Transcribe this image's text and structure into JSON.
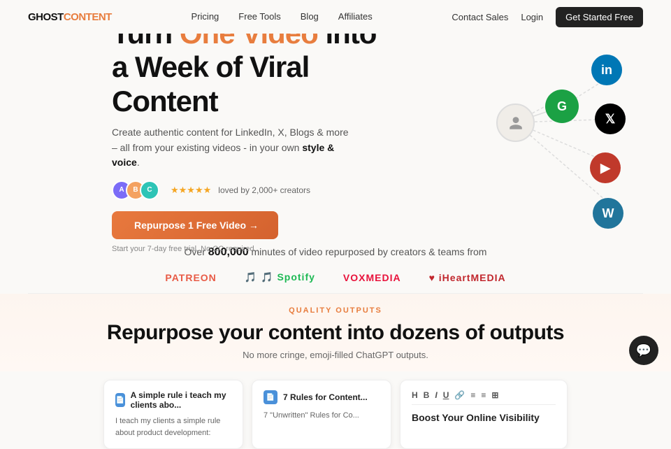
{
  "nav": {
    "logo_ghost": "GHOST",
    "logo_content": "CONTENT",
    "links": [
      {
        "label": "Pricing",
        "href": "#"
      },
      {
        "label": "Free Tools",
        "href": "#"
      },
      {
        "label": "Blog",
        "href": "#"
      },
      {
        "label": "Affiliates",
        "href": "#"
      }
    ],
    "right_links": [
      {
        "label": "Contact Sales"
      },
      {
        "label": "Login"
      },
      {
        "label": "Get Started Free"
      }
    ]
  },
  "hero": {
    "headline_start": "Turn ",
    "headline_orange": "One Video",
    "headline_end": " into a Week of Viral Content",
    "description": "Create authentic content for LinkedIn, X, Blogs & more – all from your existing videos - in your own ",
    "description_bold": "style & voice",
    "description_end": ".",
    "stars": "★★★★★",
    "loved_text": "loved by 2,000+ creators",
    "cta_button": "Repurpose 1 Free Video →",
    "free_trial": "Start your 7-day free trial. No CC required",
    "center_icon": "👤",
    "grammarly_letter": "G"
  },
  "social_icons": [
    {
      "name": "linkedin",
      "symbol": "in",
      "class": "si-linkedin"
    },
    {
      "name": "x-twitter",
      "symbol": "𝕏",
      "class": "si-x"
    },
    {
      "name": "youtube",
      "symbol": "▶",
      "class": "si-youtube"
    },
    {
      "name": "wordpress",
      "symbol": "W",
      "class": "si-wordpress"
    }
  ],
  "stats": {
    "text_before": "Over ",
    "number": "800,000",
    "text_after": " minutes of video repurposed by creators & teams from"
  },
  "brands": [
    {
      "label": "PATREON",
      "class": "patreon"
    },
    {
      "label": "Spotify",
      "class": "spotify"
    },
    {
      "label": "VOXMEDIA",
      "class": "vox"
    },
    {
      "label": "♥ iHeartMEDIA",
      "class": "iheart"
    }
  ],
  "quality_section": {
    "label": "QUALITY OUTPUTS",
    "title": "Repurpose your content into dozens of outputs",
    "subtitle": "No more cringe, emoji-filled ChatGPT outputs."
  },
  "cards": [
    {
      "icon": "📄",
      "title": "A simple rule i teach my clients abo...",
      "body": "I teach my clients a simple rule about product development:"
    },
    {
      "icon": "📄",
      "title": "7 Rules for Content...",
      "body": "7 \"Unwritten\" Rules for Co..."
    }
  ],
  "editor_card": {
    "toolbar_items": [
      "H",
      "B",
      "I",
      "U",
      "🔗",
      "≡",
      "≡",
      "⊞"
    ],
    "title": "Boost Your Online Visibility"
  },
  "chat": {
    "icon": "💬"
  }
}
